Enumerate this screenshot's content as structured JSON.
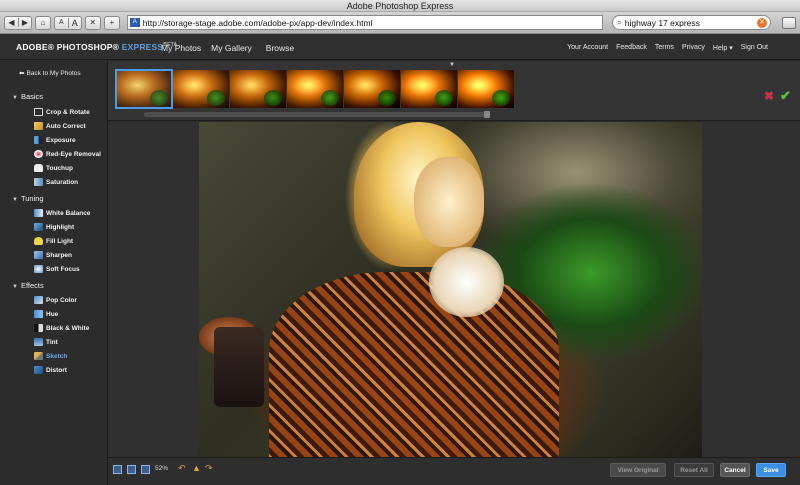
{
  "window": {
    "title": "Adobe Photoshop Express"
  },
  "browser": {
    "back_glyph": "◀",
    "forward_glyph": "▶",
    "home_glyph": "⌂",
    "font_small": "A",
    "font_large": "A",
    "stop_glyph": "✕",
    "add_glyph": "+",
    "url": "http://storage-stage.adobe.com/adobe-px/app-dev/index.html",
    "search_value": "highway 17 express"
  },
  "app": {
    "logo_brand": "ADOBE® PHOTOSHOP®",
    "logo_express": "EXPRESS",
    "logo_badge": "BETA",
    "nav": {
      "my_photos": "My Photos",
      "my_gallery": "My Gallery",
      "browse": "Browse"
    },
    "right_links": [
      "Your Account",
      "Feedback",
      "Terms",
      "Privacy",
      "Help ▾",
      "Sign Out"
    ]
  },
  "sidebar": {
    "back_label": "Back to My Photos",
    "sections": [
      {
        "title": "Basics",
        "tools": [
          "Crop & Rotate",
          "Auto Correct",
          "Exposure",
          "Red-Eye Removal",
          "Touchup",
          "Saturation"
        ]
      },
      {
        "title": "Tuning",
        "tools": [
          "White Balance",
          "Highlight",
          "Fill Light",
          "Sharpen",
          "Soft Focus"
        ]
      },
      {
        "title": "Effects",
        "tools": [
          "Pop Color",
          "Hue",
          "Black & White",
          "Tint",
          "Sketch",
          "Distort"
        ]
      }
    ],
    "active_tool": "Sketch"
  },
  "filmstrip": {
    "thumb_count": 7,
    "selected_index": 0,
    "reject_glyph": "✖",
    "accept_glyph": "✔"
  },
  "bottom": {
    "zoom": "52%",
    "view_original": "View Original",
    "reset_all": "Reset All",
    "cancel": "Cancel",
    "save": "Save"
  },
  "colors": {
    "accent": "#3b8ee0",
    "active_tool": "#6aa9ef",
    "reject": "#c6334a",
    "accept": "#5cc43a"
  }
}
